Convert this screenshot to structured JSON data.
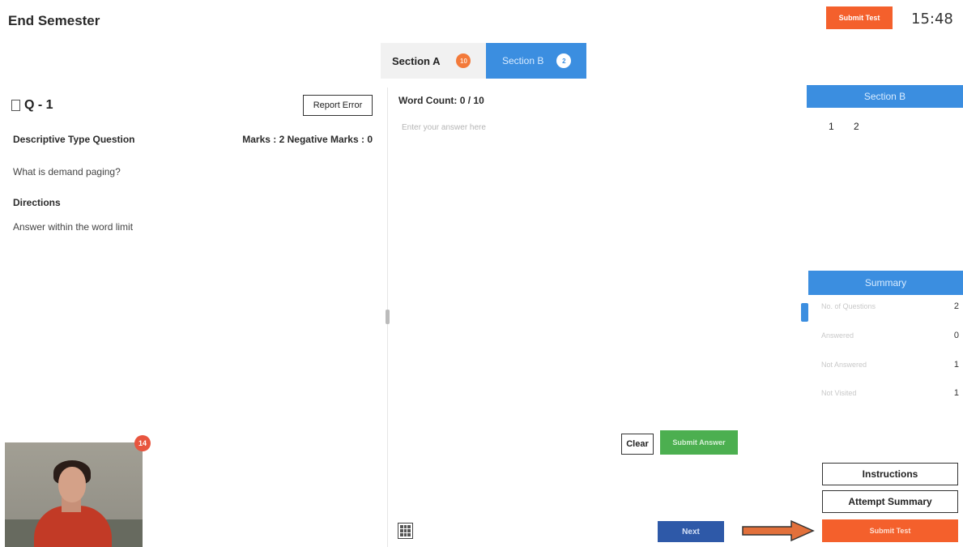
{
  "header": {
    "title": "End Semester",
    "submit_label": "Submit Test",
    "timer": "15:48"
  },
  "tabs": [
    {
      "label": "Section A",
      "badge": "10"
    },
    {
      "label": "Section B",
      "badge": "2"
    }
  ],
  "question": {
    "number": "Q - 1",
    "report_label": "Report Error",
    "type": "Descriptive Type Question",
    "marks": "Marks : 2  Negative Marks : 0",
    "text": "What is demand paging?",
    "directions_title": "Directions",
    "directions_text": "Answer within the word limit"
  },
  "answer": {
    "word_count": "Word Count: 0 / 10",
    "placeholder": "Enter your answer here",
    "clear_label": "Clear",
    "submit_label": "Submit Answer"
  },
  "nav": {
    "next_label": "Next"
  },
  "webcam": {
    "badge": "14"
  },
  "right_panel": {
    "section_title": "Section B",
    "questions": [
      "1",
      "2"
    ],
    "summary_title": "Summary",
    "summary_rows": [
      {
        "label": "No. of Questions",
        "value": "2"
      },
      {
        "label": "Answered",
        "value": "0"
      },
      {
        "label": "Not Answered",
        "value": "1"
      },
      {
        "label": "Not Visited",
        "value": "1"
      }
    ],
    "instructions_label": "Instructions",
    "attempt_summary_label": "Attempt Summary",
    "submit_label": "Submit Test"
  },
  "colors": {
    "accent_blue": "#3b8ee0",
    "submit_orange": "#f4602c",
    "answer_green": "#4caf50",
    "next_blue": "#2e59a8"
  }
}
